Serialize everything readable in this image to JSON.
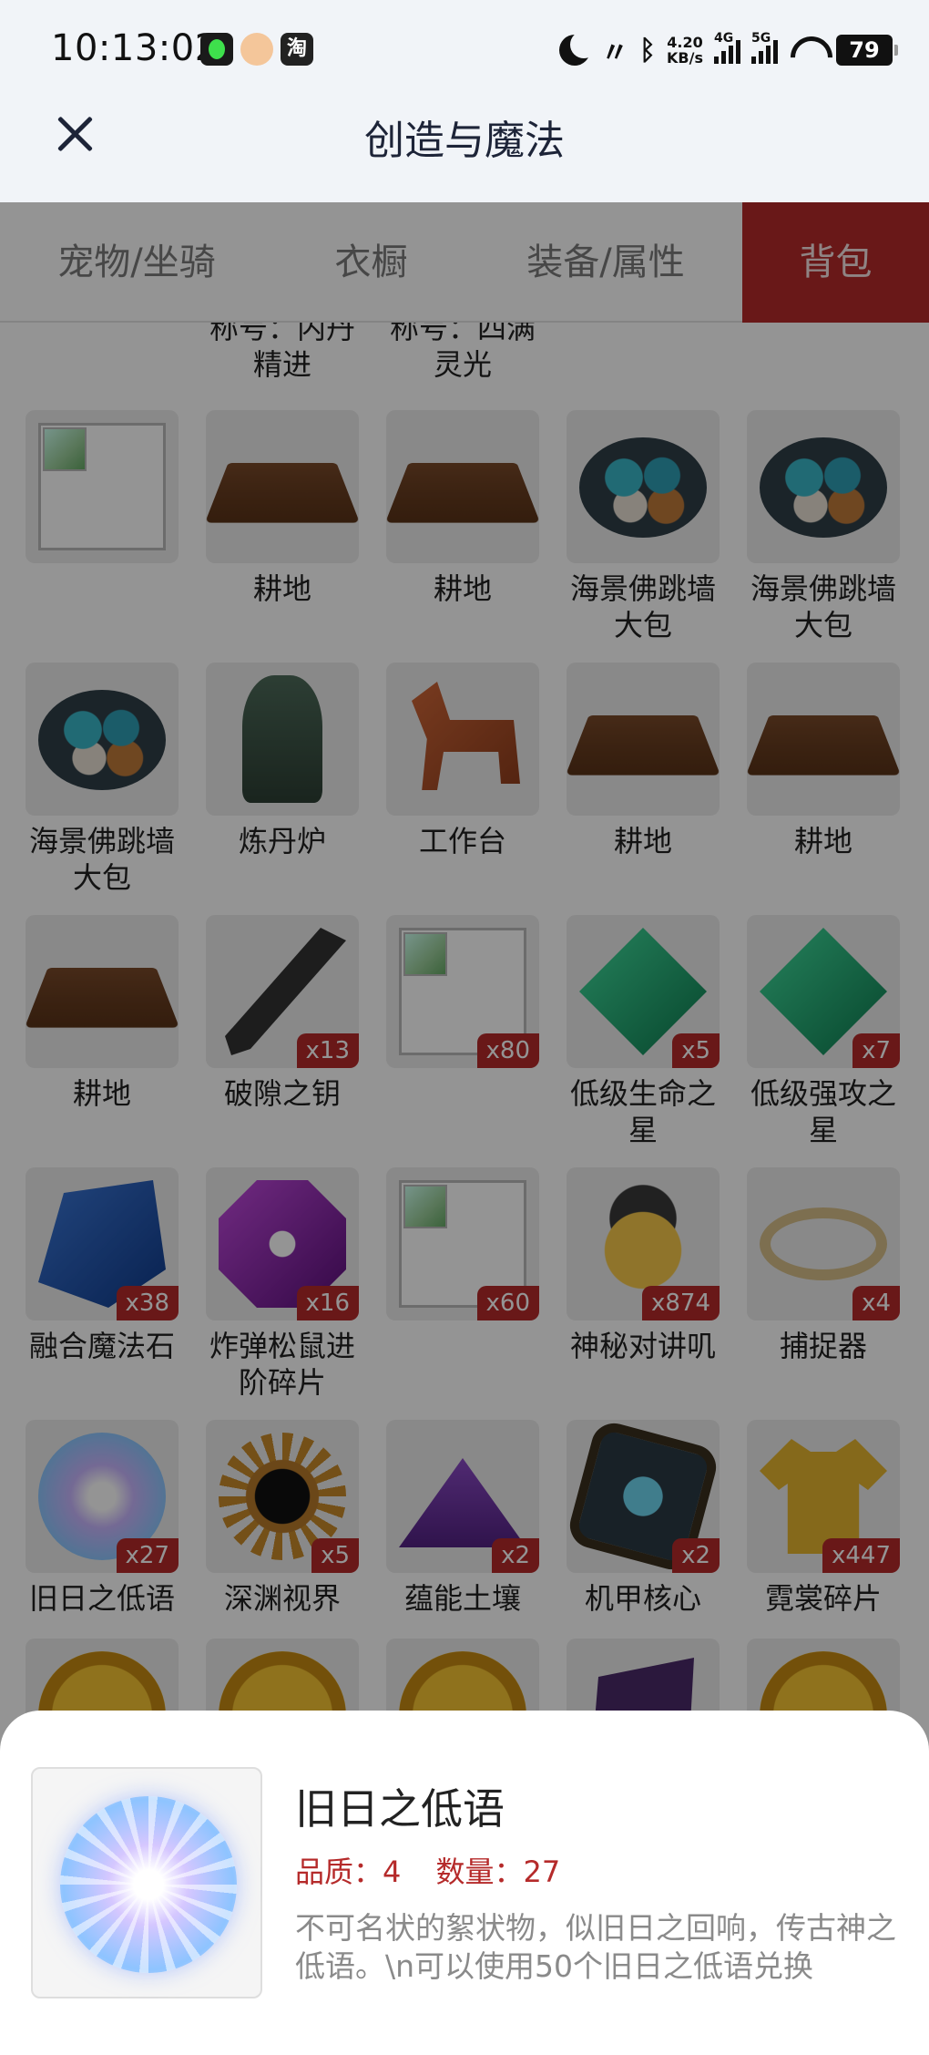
{
  "status_bar": {
    "time": "10:13:02",
    "app_icon_3": "淘",
    "net_speed_value": "4.20",
    "net_speed_unit": "KB/s",
    "signal_1_label": "4G",
    "signal_2_label": "5G",
    "battery": "79"
  },
  "header": {
    "title": "创造与魔法"
  },
  "tabs": [
    {
      "label": "宠物/坐骑"
    },
    {
      "label": "衣橱"
    },
    {
      "label": "装备/属性"
    },
    {
      "label": "背包"
    }
  ],
  "grid": {
    "partial_labels": [
      "称号：内丹\n精进",
      "称号：四满\n灵光"
    ],
    "items": [
      {
        "label": "",
        "qty": "",
        "icon": "broken-image-icon"
      },
      {
        "label": "耕地",
        "qty": "",
        "icon": "farmland-icon"
      },
      {
        "label": "耕地",
        "qty": "",
        "icon": "farmland-icon"
      },
      {
        "label": "海景佛跳墙大包",
        "qty": "",
        "icon": "dumpling-plate-icon"
      },
      {
        "label": "海景佛跳墙大包",
        "qty": "",
        "icon": "dumpling-plate-icon"
      },
      {
        "label": "海景佛跳墙大包",
        "qty": "",
        "icon": "dumpling-plate-icon"
      },
      {
        "label": "炼丹炉",
        "qty": "",
        "icon": "furnace-icon"
      },
      {
        "label": "工作台",
        "qty": "",
        "icon": "workbench-horse-icon"
      },
      {
        "label": "耕地",
        "qty": "",
        "icon": "farmland-icon"
      },
      {
        "label": "耕地",
        "qty": "",
        "icon": "farmland-icon"
      },
      {
        "label": "耕地",
        "qty": "",
        "icon": "farmland-icon"
      },
      {
        "label": "破隙之钥",
        "qty": "x13",
        "icon": "key-icon"
      },
      {
        "label": "",
        "qty": "x80",
        "icon": "broken-image-icon"
      },
      {
        "label": "低级生命之星",
        "qty": "x5",
        "icon": "green-gem-icon"
      },
      {
        "label": "低级强攻之星",
        "qty": "x7",
        "icon": "green-gem-icon"
      },
      {
        "label": "融合魔法石",
        "qty": "x38",
        "icon": "blue-stone-icon"
      },
      {
        "label": "炸弹松鼠进阶碎片",
        "qty": "x16",
        "icon": "purple-gem-icon"
      },
      {
        "label": "",
        "qty": "x60",
        "icon": "broken-image-icon"
      },
      {
        "label": "神秘对讲叽",
        "qty": "x874",
        "icon": "bird-walkie-icon"
      },
      {
        "label": "捕捉器",
        "qty": "x4",
        "icon": "thorn-ring-icon"
      },
      {
        "label": "旧日之低语",
        "qty": "x27",
        "icon": "orb-icon"
      },
      {
        "label": "深渊视界",
        "qty": "x5",
        "icon": "abyss-eye-icon"
      },
      {
        "label": "蕴能土壤",
        "qty": "x2",
        "icon": "purple-soil-icon"
      },
      {
        "label": "机甲核心",
        "qty": "x2",
        "icon": "mech-core-icon"
      },
      {
        "label": "霓裳碎片",
        "qty": "x447",
        "icon": "shirt-icon"
      },
      {
        "label": "",
        "qty": "",
        "icon": "coin-icon"
      },
      {
        "label": "",
        "qty": "",
        "icon": "coin-icon"
      },
      {
        "label": "",
        "qty": "",
        "icon": "coin-icon"
      },
      {
        "label": "",
        "qty": "",
        "icon": "flag-icon"
      },
      {
        "label": "",
        "qty": "",
        "icon": "coin-icon"
      }
    ]
  },
  "detail": {
    "name": "旧日之低语",
    "quality": "品质：4",
    "count": "数量：27",
    "description": "不可名状的絮状物，似旧日之回响，传古神之低语。\\n可以使用50个旧日之低语兑换"
  }
}
